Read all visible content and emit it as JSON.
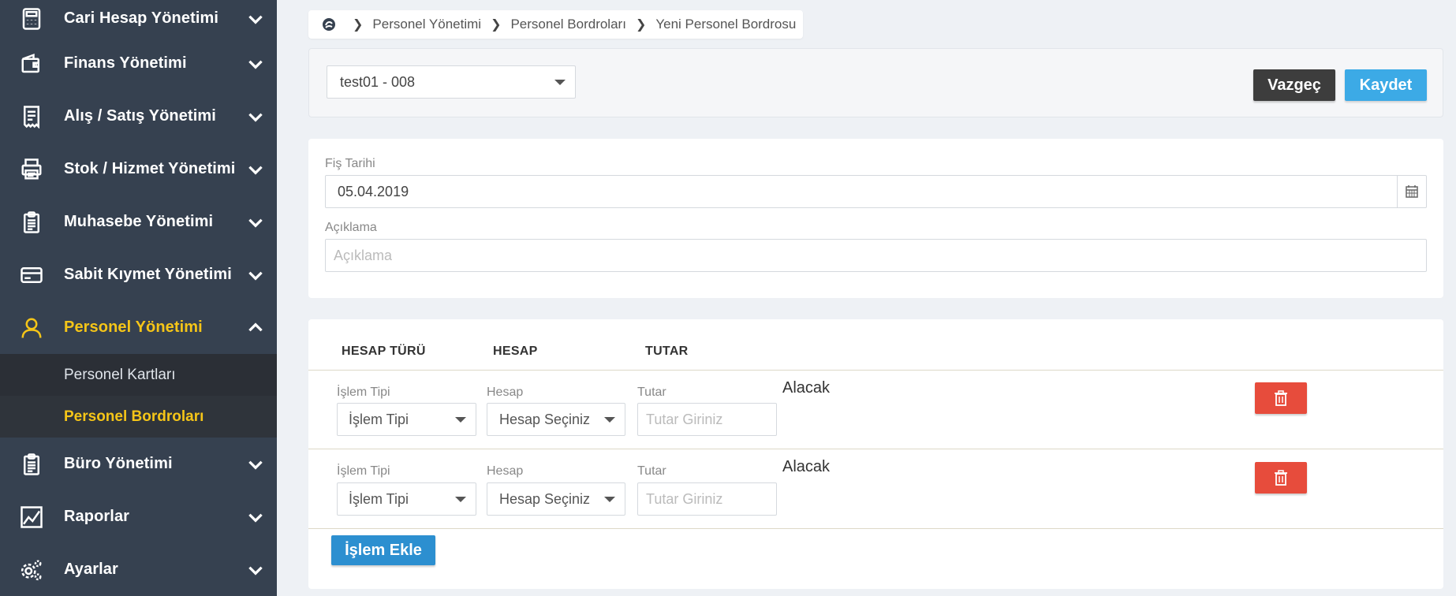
{
  "sidebar": {
    "items": [
      {
        "label": "Cari Hesap Yönetimi",
        "icon": "calculator-icon"
      },
      {
        "label": "Finans Yönetimi",
        "icon": "wallet-icon"
      },
      {
        "label": "Alış / Satış Yönetimi",
        "icon": "receipt-icon"
      },
      {
        "label": "Stok / Hizmet Yönetimi",
        "icon": "printer-icon"
      },
      {
        "label": "Muhasebe Yönetimi",
        "icon": "clipboard-icon"
      },
      {
        "label": "Sabit Kıymet Yönetimi",
        "icon": "credit-card-icon"
      },
      {
        "label": "Personel Yönetimi",
        "icon": "user-icon"
      },
      {
        "label": "Büro Yönetimi",
        "icon": "clipboard-list-icon"
      },
      {
        "label": "Raporlar",
        "icon": "chart-icon"
      },
      {
        "label": "Ayarlar",
        "icon": "gears-icon"
      }
    ],
    "sub_items": [
      {
        "label": "Personel Kartları"
      },
      {
        "label": "Personel Bordroları"
      }
    ]
  },
  "breadcrumb": {
    "items": [
      "Personel Yönetimi",
      "Personel Bordroları",
      "Yeni Personel Bordrosu"
    ]
  },
  "top": {
    "company_select": "test01 - 008",
    "cancel_label": "Vazgeç",
    "save_label": "Kaydet"
  },
  "form": {
    "date_label": "Fiş Tarihi",
    "date_value": "05.04.2019",
    "desc_label": "Açıklama",
    "desc_placeholder": "Açıklama"
  },
  "lines": {
    "headers": [
      "HESAP TÜRÜ",
      "HESAP",
      "TUTAR"
    ],
    "rows": [
      {
        "type_label": "İşlem Tipi",
        "type_value": "İşlem Tipi",
        "account_label": "Hesap",
        "account_value": "Hesap Seçiniz",
        "amount_label": "Tutar",
        "amount_placeholder": "Tutar Giriniz",
        "side": "Alacak"
      },
      {
        "type_label": "İşlem Tipi",
        "type_value": "İşlem Tipi",
        "account_label": "Hesap",
        "account_value": "Hesap Seçiniz",
        "amount_label": "Tutar",
        "amount_placeholder": "Tutar Giriniz",
        "side": "Alacak"
      }
    ],
    "add_label": "İşlem Ekle"
  },
  "colors": {
    "sidebar_bg": "#364150",
    "active_accent": "#f5c518",
    "save_blue": "#3caae6",
    "add_blue": "#2c8fd0",
    "delete_red": "#e74c3c",
    "cancel_dark": "#3d3d3d"
  }
}
